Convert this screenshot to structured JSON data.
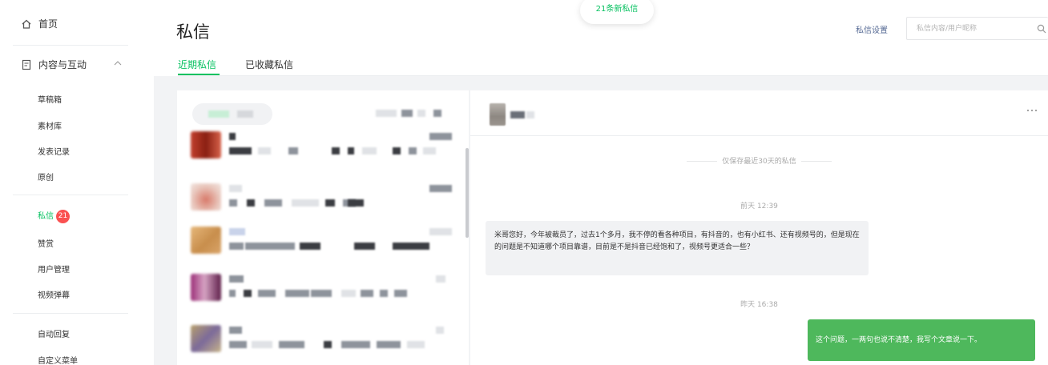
{
  "sidebar": {
    "home_label": "首页",
    "group_label": "内容与互动",
    "group_items": [
      {
        "label": "草稿箱"
      },
      {
        "label": "素材库"
      },
      {
        "label": "发表记录"
      },
      {
        "label": "原创"
      }
    ],
    "message_item": {
      "label": "私信",
      "badge": "21"
    },
    "items2": [
      {
        "label": "赞赏"
      },
      {
        "label": "用户管理"
      },
      {
        "label": "视频弹幕"
      }
    ],
    "items3": [
      {
        "label": "自动回复"
      },
      {
        "label": "自定义菜单"
      }
    ]
  },
  "header": {
    "title": "私信",
    "new_messages_pill": "21条新私信",
    "settings_label": "私信设置",
    "search_placeholder": "私信内容/用户昵称"
  },
  "tabs": [
    {
      "label": "近期私信",
      "active": true
    },
    {
      "label": "已收藏私信",
      "active": false
    }
  ],
  "chat": {
    "retention_notice": "仅保存最近30天的私信",
    "messages": [
      {
        "time": "前天 12:39",
        "direction": "incoming",
        "text": "米哥您好，今年被裁员了，过去1个多月，我不停的看各种项目，有抖音的，也有小红书、还有视频号的，但是现在的问题是不知道哪个项目靠谱，目前是不是抖音已经饱和了，视频号更适合一些？"
      },
      {
        "time": "昨天 16:38",
        "direction": "outgoing",
        "text": "这个问题，一两句也说不清楚，我写个文章说一下。"
      }
    ]
  },
  "colors": {
    "accent": "#07c160",
    "badge": "#fa5151",
    "link": "#576b95",
    "outgoing_bubble": "#4eb85c",
    "incoming_bubble": "#f1f2f4"
  }
}
